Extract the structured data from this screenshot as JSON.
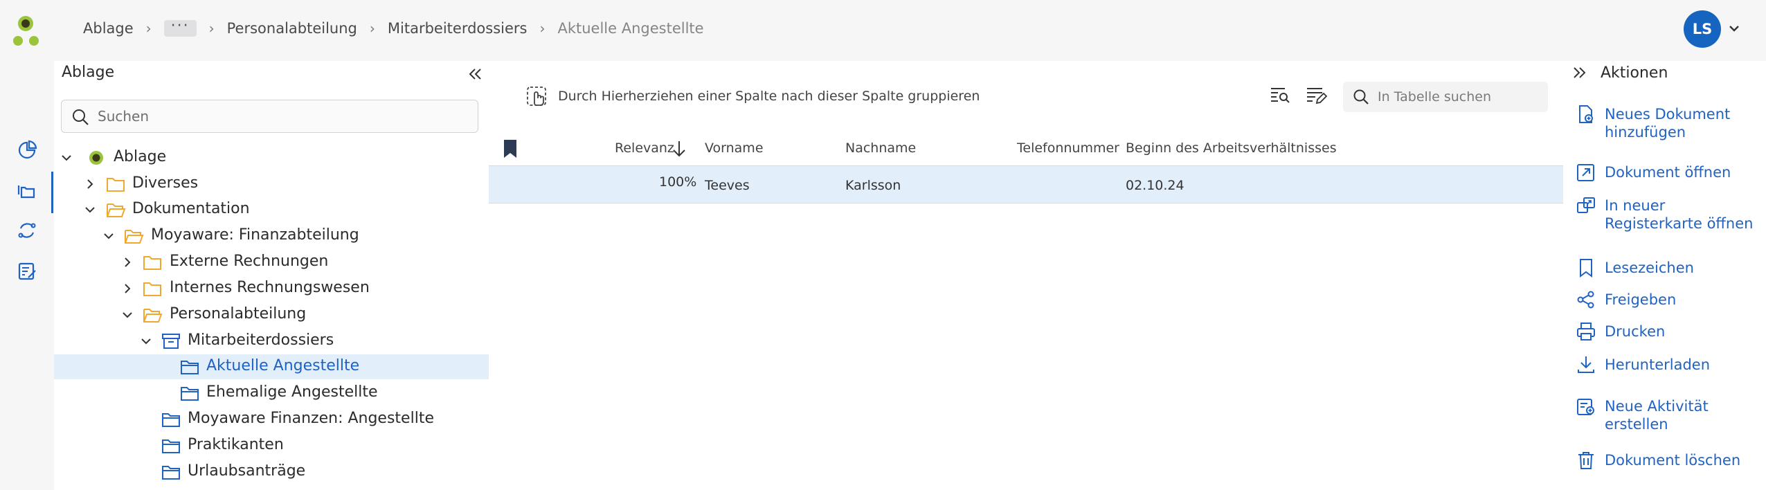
{
  "header": {
    "breadcrumb": [
      {
        "label": "Ablage"
      },
      {
        "label": "···"
      },
      {
        "label": "Personalabteilung"
      },
      {
        "label": "Mitarbeiterdossiers"
      },
      {
        "label": "Aktuelle Angestellte"
      }
    ],
    "avatar_initials": "LS"
  },
  "sidebar": {
    "title": "Ablage",
    "search_placeholder": "Suchen",
    "tree": [
      {
        "label": "Ablage",
        "icon": "ablage-root-icon"
      },
      {
        "label": "Diverses",
        "icon": "folder-icon"
      },
      {
        "label": "Dokumentation",
        "icon": "folder-open-icon"
      },
      {
        "label": "Moyaware: Finanzabteilung",
        "icon": "folder-open-icon"
      },
      {
        "label": "Externe Rechnungen",
        "icon": "folder-icon"
      },
      {
        "label": "Internes Rechnungswesen",
        "icon": "folder-icon"
      },
      {
        "label": "Personalabteilung",
        "icon": "folder-open-icon"
      },
      {
        "label": "Mitarbeiterdossiers",
        "icon": "archive-box-icon"
      },
      {
        "label": "Aktuelle Angestellte",
        "icon": "blue-folder-icon"
      },
      {
        "label": "Ehemalige Angestellte",
        "icon": "blue-folder-icon"
      },
      {
        "label": "Moyaware Finanzen: Angestellte",
        "icon": "blue-folder-icon"
      },
      {
        "label": "Praktikanten",
        "icon": "blue-folder-icon"
      },
      {
        "label": "Urlaubsanträge",
        "icon": "blue-folder-icon"
      }
    ]
  },
  "main": {
    "group_hint": "Durch Hierherziehen einer Spalte nach dieser Spalte gruppieren",
    "table_search_placeholder": "In Tabelle suchen",
    "columns": [
      "Relevanz",
      "Vorname",
      "Nachname",
      "Telefonnummer",
      "Beginn des Arbeitsverhältnisses"
    ],
    "rows": [
      {
        "relevanz": "100%",
        "vorname": "Teeves",
        "nachname": "Karlsson",
        "telefon": "",
        "beginn": "02.10.24"
      }
    ]
  },
  "actions": {
    "title": "Aktionen",
    "items": [
      {
        "label": "Neues Dokument hinzufügen",
        "icon": "new-document-icon"
      },
      {
        "label": "Dokument öffnen",
        "icon": "open-external-icon"
      },
      {
        "label": "In neuer Registerkarte öffnen",
        "icon": "new-tab-icon"
      },
      {
        "label": "Lesezeichen",
        "icon": "bookmark-icon"
      },
      {
        "label": "Freigeben",
        "icon": "share-icon"
      },
      {
        "label": "Drucken",
        "icon": "print-icon"
      },
      {
        "label": "Herunterladen",
        "icon": "download-icon"
      },
      {
        "label": "Neue Aktivität erstellen",
        "icon": "new-activity-icon"
      },
      {
        "label": "Dokument löschen",
        "icon": "trash-icon"
      }
    ]
  },
  "colors": {
    "accent": "#1e63c4",
    "selection": "#e3eefb",
    "folder_orange": "#f0a82f",
    "logo_green": "#9bc33b"
  }
}
